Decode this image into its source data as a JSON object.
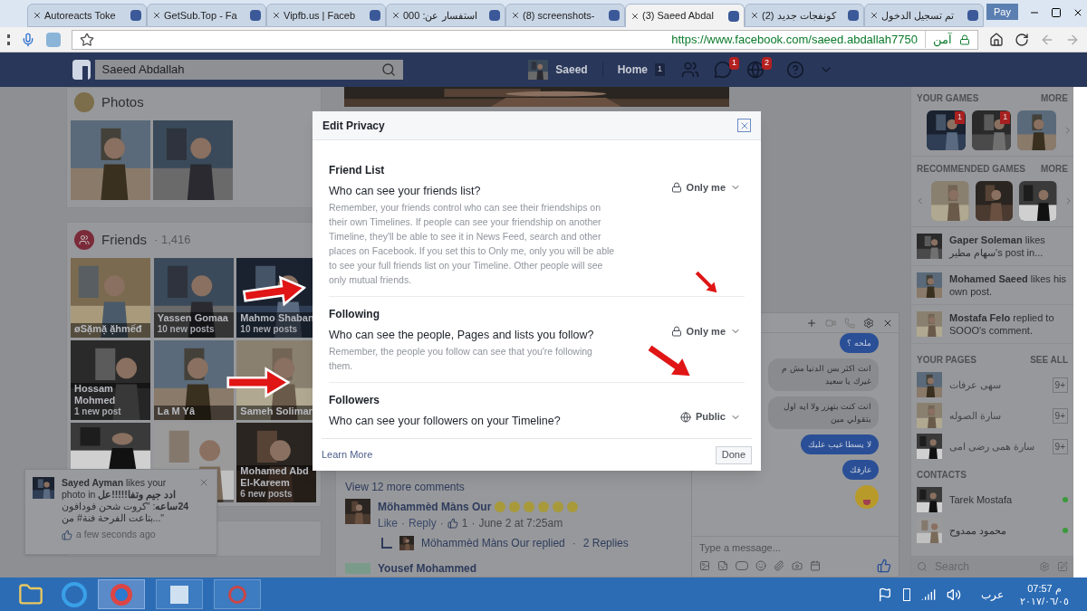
{
  "browser": {
    "tabs": [
      {
        "label": "Autoreacts Toke",
        "selected": false
      },
      {
        "label": "GetSub.Top - Fa",
        "selected": false
      },
      {
        "label": "Vipfb.us | Faceb",
        "selected": false
      },
      {
        "label": "استفسار عن: 000",
        "selected": false
      },
      {
        "label": "(8) screenshots-",
        "selected": false
      },
      {
        "label": "(3) Saeed Abdal",
        "selected": true
      },
      {
        "label": "(2) كونفجات جديد",
        "selected": false
      },
      {
        "label": "تم تسجيل الدخول",
        "selected": false
      }
    ],
    "pay_button": "Pay",
    "secure_label": "آمن",
    "url": "https://www.facebook.com/saeed.abdallah7750"
  },
  "header": {
    "search_value": "Saeed Abdallah",
    "profile_name": "Saeed",
    "home": "Home",
    "home_count": "1",
    "messages_badge": "1",
    "notifications_badge": "2"
  },
  "photos": {
    "title": "Photos"
  },
  "friends": {
    "title": "Friends",
    "count": "· 1,416",
    "tiles": [
      {
        "kind": "picture",
        "name": "øSặmặ ặhmếđ"
      },
      {
        "kind": "picture",
        "name": "Yassen Gomaa",
        "posts": "10 new posts"
      },
      {
        "kind": "picture",
        "name": "Mahmo Shaban",
        "posts": "10 new posts"
      },
      {
        "kind": "picture",
        "name": "Hossam Mohmed",
        "posts": "1 new post"
      },
      {
        "kind": "picture",
        "name": "La M Yâ"
      },
      {
        "kind": "picture",
        "name": "Sameh Soliman"
      },
      {
        "kind": "picture"
      },
      {
        "kind": "picture"
      },
      {
        "kind": "picture",
        "name": "Mohamed Abd El-Kareem",
        "posts": "6 new posts"
      }
    ]
  },
  "notification": {
    "text": "**Sayed Ayman** likes your photo in **ادد جيم وتفا!!!!!عل 24ساعه**: \"كروت شحن فودافون بتاعت الفرحة فنة# من...\"",
    "time": "a few seconds ago"
  },
  "modal": {
    "title": "Edit Privacy",
    "sections": [
      {
        "heading": "Friend List",
        "question": "Who can see your friends list?",
        "note": "Remember, your friends control who can see their friendships on their own Timelines. If people can see your friendship on another Timeline, they'll be able to see it in News Feed, search and other places on Facebook. If you set this to Only me, only you will be able to see your full friends list on your Timeline. Other people will see only mutual friends.",
        "audience": "Only me",
        "public": false
      },
      {
        "heading": "Following",
        "question": "Who can see the people, Pages and lists you follow?",
        "note": "Remember, the people you follow can see that you're following them.",
        "audience": "Only me",
        "public": false
      },
      {
        "heading": "Followers",
        "question": "Who can see your followers on your Timeline?",
        "audience": "Public",
        "public": true
      }
    ],
    "learn_more": "Learn More",
    "done": "Done"
  },
  "feed": {
    "view_more": "View 12 more comments",
    "comment": {
      "author": "Möhammèd Màns Our",
      "like": "Like",
      "reply": "Reply",
      "likes": "1",
      "time": "June 2 at 7:25am",
      "separators": [
        "·",
        "·",
        "·"
      ]
    },
    "reply_separator": "·",
    "reply_author": "Möhammèd Màns Our replied",
    "reply_count": "2 Replies",
    "next_author": "Yousef Mohammed"
  },
  "chat": {
    "messages": [
      {
        "kind": "sent",
        "text": "ملحه ؟"
      },
      {
        "kind": "received",
        "text": "انت اكثر بس الدنيا مش م غيرك يا سعيد"
      },
      {
        "kind": "received",
        "text": "انت كنت بتهزر ولا ايه اول بتقولي مين"
      },
      {
        "kind": "sent",
        "text": "لا يسطا عيب عليك"
      },
      {
        "kind": "sent",
        "text": "عارفك"
      }
    ],
    "placeholder": "Type a message..."
  },
  "sidebar": {
    "games_title": "YOUR GAMES",
    "games_more": "MORE",
    "games": [
      {
        "kind": "picture",
        "badge": "1"
      },
      {
        "kind": "picture",
        "badge": "1"
      },
      {
        "kind": "picture"
      }
    ],
    "recommended_title": "RECOMMENDED GAMES",
    "recommended_more": "MORE",
    "activity": [
      {
        "text": "**Gaper Soleman** likes سهام مطير's post in..."
      },
      {
        "text": "**Mohamed Saeed** likes his own post."
      },
      {
        "text": "**Mostafa Felo** replied to SOOO's comment."
      }
    ],
    "pages_title": "YOUR PAGES",
    "pages_see_all": "SEE ALL",
    "pages": [
      {
        "name": "سهى عرفات",
        "count": "9+"
      },
      {
        "name": "سارة الصوله",
        "count": "9+"
      },
      {
        "name": "سارة همى رضى امى",
        "count": "9+"
      }
    ],
    "contacts_title": "CONTACTS",
    "contacts": [
      {
        "name": "Tarek Mostafa",
        "online": true
      },
      {
        "name": "محمود ممدوح",
        "online": true
      }
    ],
    "search_placeholder": "Search"
  },
  "taskbar": {
    "language": "عرب",
    "time": "07:57 م",
    "date": "٢٠١٧/٠٦/٠٥"
  }
}
